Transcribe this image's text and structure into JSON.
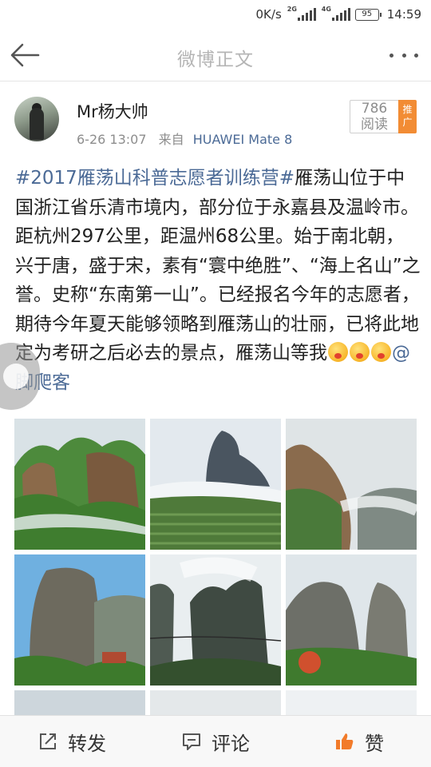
{
  "status_bar": {
    "speed": "0K/s",
    "sim1_tag": "2G",
    "sim2_tag": "4G",
    "battery": "95",
    "time": "14:59"
  },
  "nav": {
    "title": "微博正文",
    "back_icon": "back-arrow-icon",
    "more_icon": "more-dots-icon"
  },
  "post": {
    "author": "Mr杨大帅",
    "date": "6-26 13:07",
    "source_prefix": "来自",
    "source": "HUAWEI Mate 8",
    "read_count": "786",
    "read_label": "阅读",
    "promote_label": "推广",
    "hashtag": "#2017雁荡山科普志愿者训练营#",
    "text": "雁荡山位于中国浙江省乐清市境内，部分位于永嘉县及温岭市。距杭州297公里，距温州68公里。始于南北朝，兴于唐，盛于宋，素有“寰中绝胜”、“海上名山”之誉。史称“东南第一山”。已经报名今年的志愿者，期待今年夏天能够领略到雁荡山的壮丽，已将此地定为考研之后必去的景点，雁荡山等我",
    "emoji_count": 3,
    "mention": "@脚爬客"
  },
  "images": {
    "count_visible": 6,
    "items": [
      "mountain-photo-1",
      "mountain-photo-2",
      "mountain-photo-3",
      "mountain-photo-4",
      "mountain-photo-5",
      "mountain-photo-6"
    ]
  },
  "actions": {
    "repost": "转发",
    "comment": "评论",
    "like": "赞",
    "like_color": "#f27b2a"
  }
}
